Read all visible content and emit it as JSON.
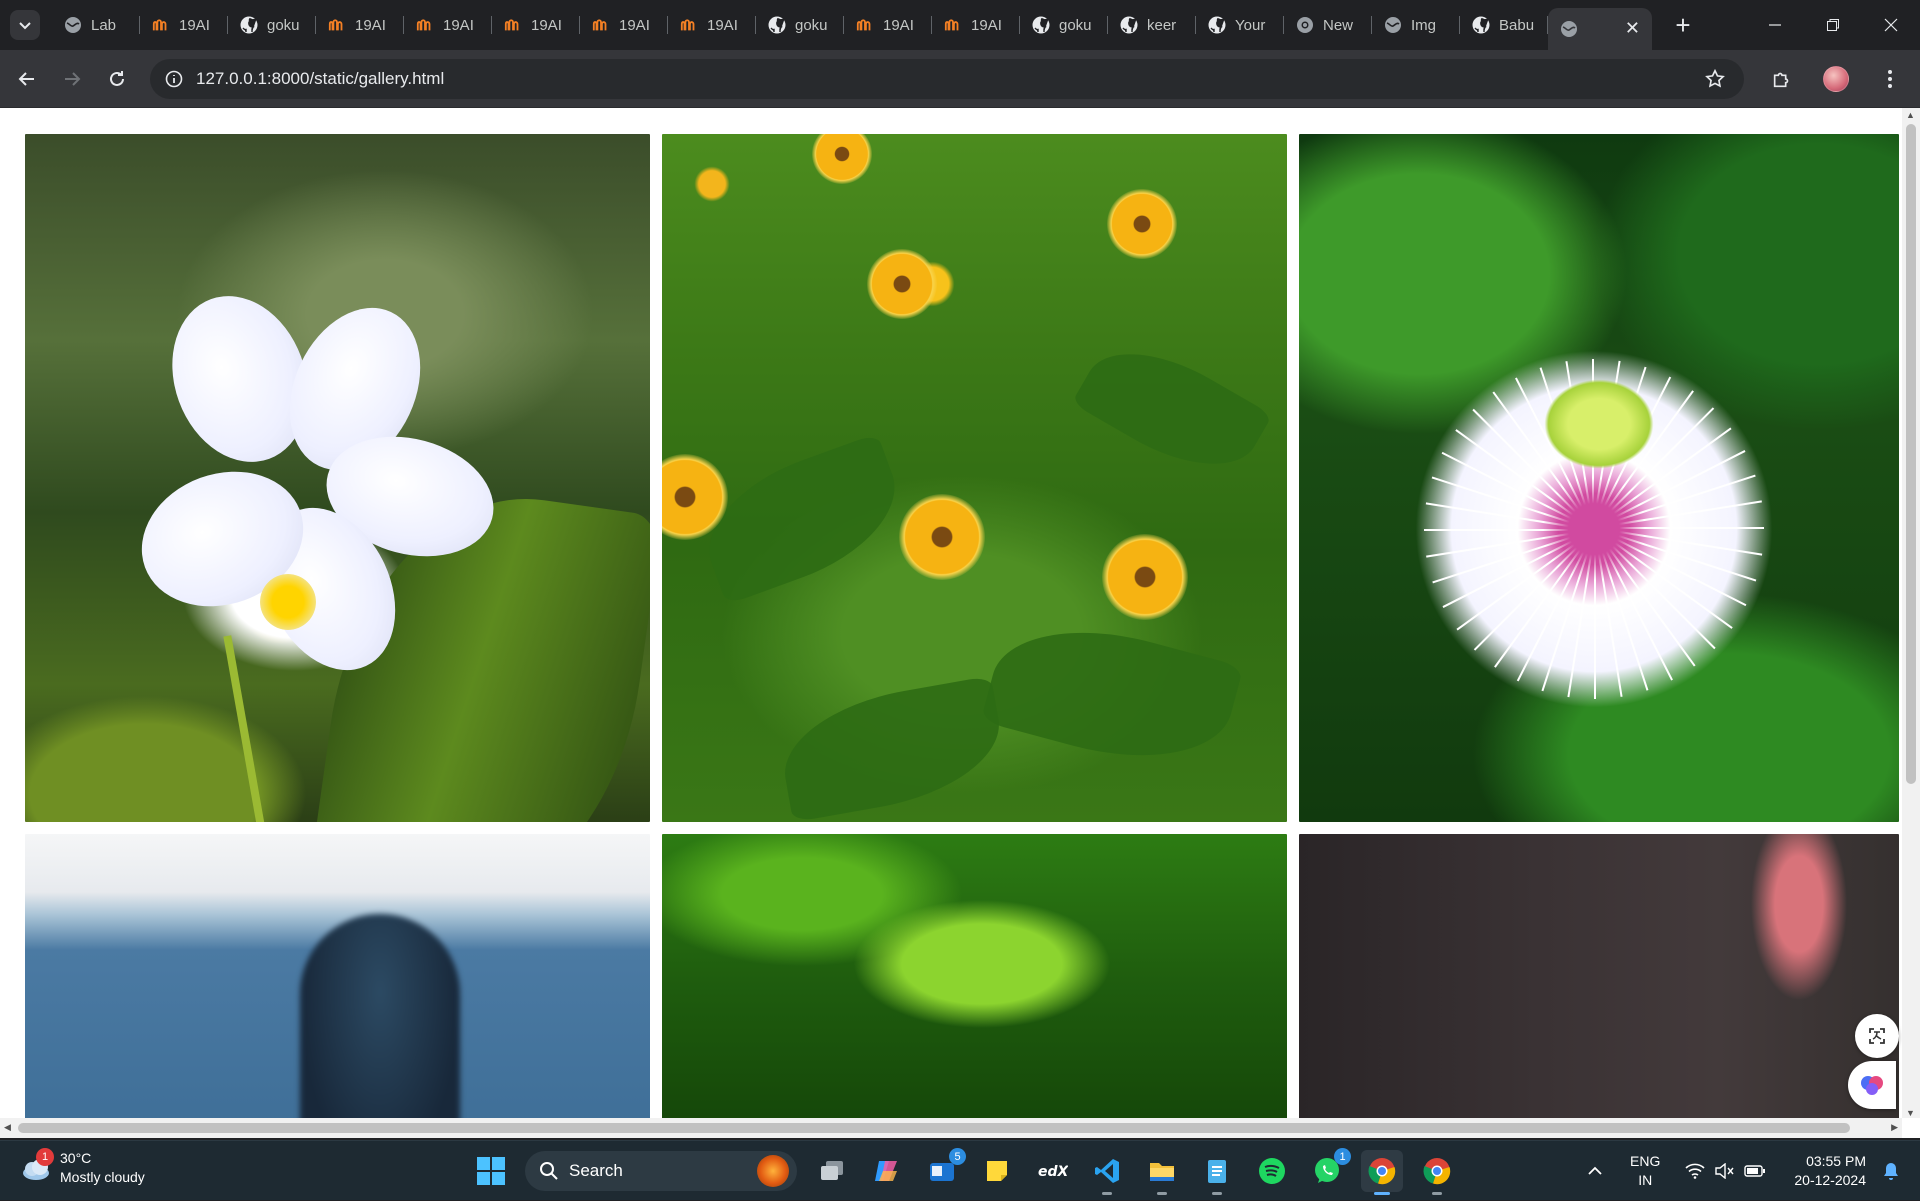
{
  "browser": {
    "tabs": [
      {
        "title": "Lab",
        "icon": "globe-icon"
      },
      {
        "title": "19AI",
        "icon": "brand-icon"
      },
      {
        "title": "goku",
        "icon": "github-icon"
      },
      {
        "title": "19AI",
        "icon": "brand-icon"
      },
      {
        "title": "19AI",
        "icon": "brand-icon"
      },
      {
        "title": "19AI",
        "icon": "brand-icon"
      },
      {
        "title": "19AI",
        "icon": "brand-icon"
      },
      {
        "title": "19AI",
        "icon": "brand-icon"
      },
      {
        "title": "goku",
        "icon": "github-icon"
      },
      {
        "title": "19AI",
        "icon": "brand-icon"
      },
      {
        "title": "19AI",
        "icon": "brand-icon"
      },
      {
        "title": "goku",
        "icon": "github-icon"
      },
      {
        "title": "keer",
        "icon": "github-icon"
      },
      {
        "title": "Your",
        "icon": "github-icon"
      },
      {
        "title": "New",
        "icon": "chrome-settings-icon"
      },
      {
        "title": "Img",
        "icon": "globe-icon"
      },
      {
        "title": "Babu",
        "icon": "github-icon"
      }
    ],
    "active_tab": {
      "title": "",
      "icon": "globe-icon"
    },
    "url": "127.0.0.1:8000/static/gallery.html"
  },
  "gallery": {
    "photos": [
      {
        "subject": "white plumeria flower"
      },
      {
        "subject": "yellow daisies"
      },
      {
        "subject": "passion flower"
      },
      {
        "subject": "blurred sky and figure"
      },
      {
        "subject": "green leaves"
      },
      {
        "subject": "dark blurred scene"
      }
    ]
  },
  "taskbar": {
    "weather": {
      "temp": "30°C",
      "condition": "Mostly cloudy",
      "badge": "1"
    },
    "search_label": "Search",
    "teams_badge": "5",
    "whatsapp_badge": "1",
    "language": {
      "line1": "ENG",
      "line2": "IN"
    },
    "clock": {
      "time": "03:55 PM",
      "date": "20-12-2024"
    }
  },
  "colors": {
    "accent": "#5fb2ff",
    "brand_tab": "#f48024"
  }
}
